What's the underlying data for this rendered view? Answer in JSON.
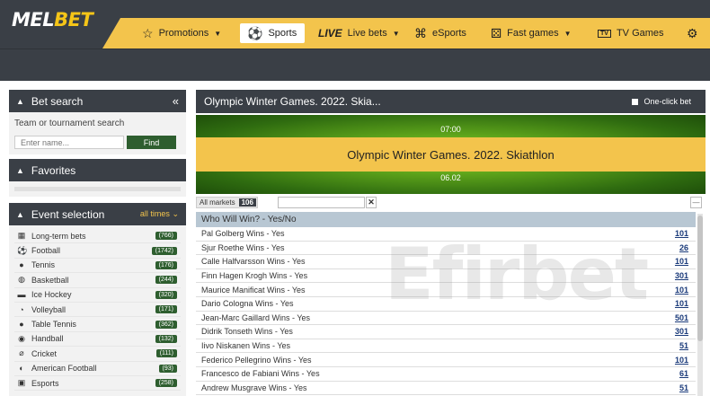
{
  "brand": {
    "logo_main": "MEL",
    "logo_accent": "BET"
  },
  "nav": {
    "promotions": "Promotions",
    "sports": "Sports",
    "live_word": "LIVE",
    "live_bets": "Live bets",
    "esports": "eSports",
    "fast_games": "Fast games",
    "tv_games": "TV Games",
    "tv_icon_label": "TV"
  },
  "sidebar": {
    "bet_search": {
      "title": "Bet search",
      "label": "Team or tournament search",
      "placeholder": "Enter name...",
      "find": "Find"
    },
    "favorites": {
      "title": "Favorites"
    },
    "event_selection": {
      "title": "Event selection",
      "filter": "all times",
      "items": [
        {
          "label": "Long-term bets",
          "count": "766",
          "icon": "trophy-icon",
          "glyph": "▦"
        },
        {
          "label": "Football",
          "count": "1742",
          "icon": "football-icon",
          "glyph": "⚽"
        },
        {
          "label": "Tennis",
          "count": "176",
          "icon": "tennis-icon",
          "glyph": "●"
        },
        {
          "label": "Basketball",
          "count": "244",
          "icon": "basketball-icon",
          "glyph": "◍"
        },
        {
          "label": "Ice Hockey",
          "count": "320",
          "icon": "ice-hockey-icon",
          "glyph": "▬"
        },
        {
          "label": "Volleyball",
          "count": "171",
          "icon": "volleyball-icon",
          "glyph": "◔"
        },
        {
          "label": "Table Tennis",
          "count": "362",
          "icon": "table-tennis-icon",
          "glyph": "●"
        },
        {
          "label": "Handball",
          "count": "132",
          "icon": "handball-icon",
          "glyph": "◉"
        },
        {
          "label": "Cricket",
          "count": "111",
          "icon": "cricket-icon",
          "glyph": "⌀"
        },
        {
          "label": "American Football",
          "count": "93",
          "icon": "american-football-icon",
          "glyph": "◐"
        },
        {
          "label": "Esports",
          "count": "258",
          "icon": "esports-icon",
          "glyph": "▣"
        }
      ]
    }
  },
  "main": {
    "title": "Olympic Winter Games. 2022. Skia...",
    "one_click_bet": "One-click bet",
    "banner": {
      "time": "07:00",
      "event": "Olympic Winter Games. 2022. Skiathlon",
      "date": "06.02"
    },
    "all_markets": "All markets",
    "markets_count": "106",
    "market": {
      "title": "Who Will Win? - Yes/No",
      "rows": [
        {
          "label": "Pal Golberg Wins - Yes",
          "odd": "101"
        },
        {
          "label": "Sjur Roethe Wins - Yes",
          "odd": "26"
        },
        {
          "label": "Calle Halfvarsson Wins - Yes",
          "odd": "101"
        },
        {
          "label": "Finn Hagen Krogh Wins - Yes",
          "odd": "301"
        },
        {
          "label": "Maurice Manificat Wins - Yes",
          "odd": "101"
        },
        {
          "label": "Dario Cologna Wins - Yes",
          "odd": "101"
        },
        {
          "label": "Jean-Marc Gaillard Wins - Yes",
          "odd": "501"
        },
        {
          "label": "Didrik Tonseth Wins - Yes",
          "odd": "301"
        },
        {
          "label": "Iivo Niskanen Wins - Yes",
          "odd": "51"
        },
        {
          "label": "Federico Pellegrino Wins - Yes",
          "odd": "101"
        },
        {
          "label": "Francesco de Fabiani Wins - Yes",
          "odd": "61"
        },
        {
          "label": "Andrew Musgrave Wins - Yes",
          "odd": "51"
        }
      ]
    }
  },
  "watermark": "Efirbet"
}
